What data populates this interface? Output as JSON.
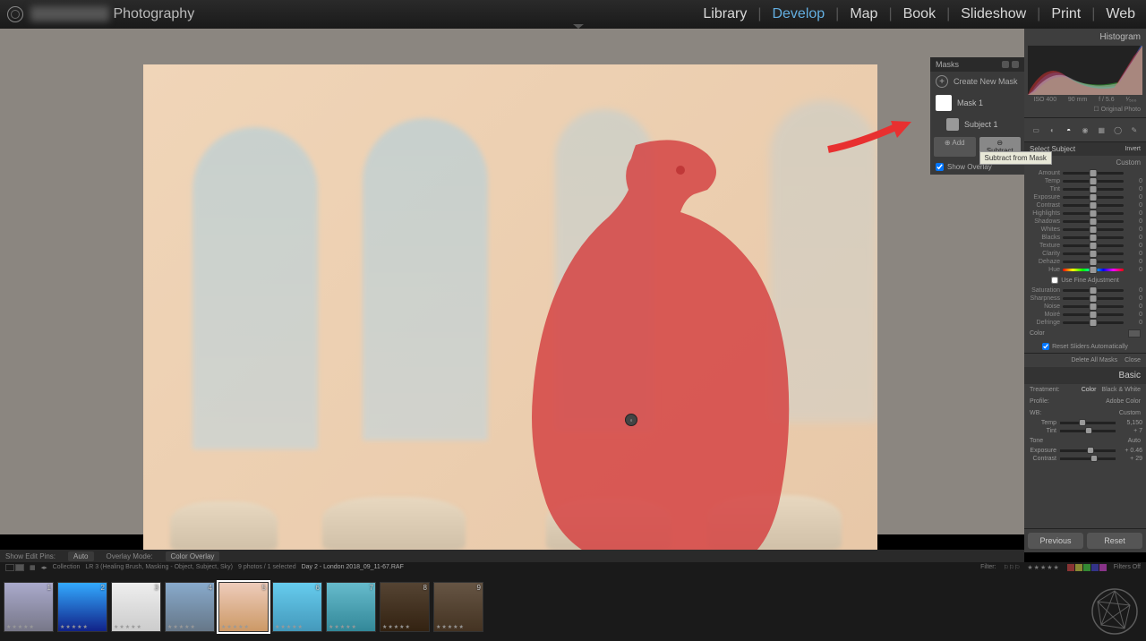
{
  "topbar": {
    "brand_suffix": "Photography",
    "modules": [
      "Library",
      "Develop",
      "Map",
      "Book",
      "Slideshow",
      "Print",
      "Web"
    ],
    "active_module": "Develop"
  },
  "masks_panel": {
    "title": "Masks",
    "create": "Create New Mask",
    "mask_name": "Mask 1",
    "component": "Subject 1",
    "add": "Add",
    "subtract": "Subtract",
    "tooltip": "Subtract from Mask",
    "show_overlay": "Show Overlay"
  },
  "histogram": {
    "title": "Histogram",
    "iso": "ISO 400",
    "focal": "90 mm",
    "aperture": "f / 5.6",
    "shutter": "¹⁄₅₀₀",
    "original": "Original Photo"
  },
  "mask_adjust": {
    "select": "Select Subject",
    "invert": "Invert",
    "effect": "Effect:",
    "effect_val": "Custom",
    "sliders": [
      "Amount",
      "Temp",
      "Tint",
      "Exposure",
      "Contrast",
      "Highlights",
      "Shadows",
      "Whites",
      "Blacks",
      "Texture",
      "Clarity",
      "Dehaze",
      "Hue",
      "Saturation",
      "Sharpness",
      "Noise",
      "Moiré",
      "Defringe"
    ],
    "fine_adj": "Use Fine Adjustment",
    "color": "Color",
    "reset_auto": "Reset Sliders Automatically",
    "delete_all": "Delete All Masks",
    "close": "Close"
  },
  "basic": {
    "title": "Basic",
    "treatment": "Treatment:",
    "color": "Color",
    "bw": "Black & White",
    "profile": "Profile:",
    "profile_val": "Adobe Color",
    "wb": "WB:",
    "wb_val": "Custom",
    "temp": {
      "label": "Temp",
      "value": "5,150"
    },
    "tint": {
      "label": "Tint",
      "value": "+ 7"
    },
    "tone": "Tone",
    "auto": "Auto",
    "exposure": {
      "label": "Exposure",
      "value": "+ 0.46"
    },
    "contrast": {
      "label": "Contrast",
      "value": "+ 29"
    }
  },
  "nav": {
    "previous": "Previous",
    "reset": "Reset"
  },
  "info_bar": {
    "show_pins": "Show Edit Pins:",
    "show_pins_val": "Auto",
    "overlay_mode": "Overlay Mode:",
    "overlay_val": "Color Overlay"
  },
  "filter_bar": {
    "collection": "Collection",
    "path": "LR 3 (Healing Brush, Masking - Object, Subject, Sky)",
    "count": "9 photos / 1 selected",
    "current": "Day 2 - London 2018_09_11-67.RAF",
    "filter": "Filter:",
    "filters_off": "Filters Off"
  },
  "filmstrip": {
    "count": 9,
    "selected": 5
  }
}
